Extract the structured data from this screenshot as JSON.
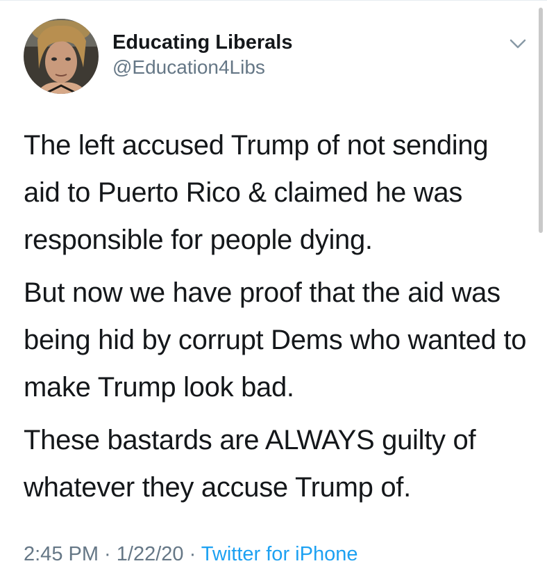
{
  "user": {
    "display_name": "Educating Liberals",
    "handle": "@Education4Libs",
    "avatar": "avatar-photo"
  },
  "menu": {
    "icon": "chevron-down-icon"
  },
  "tweet": {
    "paragraphs": [
      "The left accused Trump of not sending aid to Puerto Rico & claimed he was responsible for people dying.",
      "But now we have proof that the aid was being hid by corrupt Dems who wanted to make Trump look bad.",
      "These bastards are ALWAYS guilty of whatever they accuse Trump of."
    ]
  },
  "footer": {
    "time": "2:45 PM",
    "separator": " · ",
    "date": "1/22/20",
    "source": "Twitter for iPhone"
  },
  "colors": {
    "text": "#14171a",
    "secondary": "#657786",
    "link": "#1da1f2",
    "chevron": "#8899a6"
  }
}
